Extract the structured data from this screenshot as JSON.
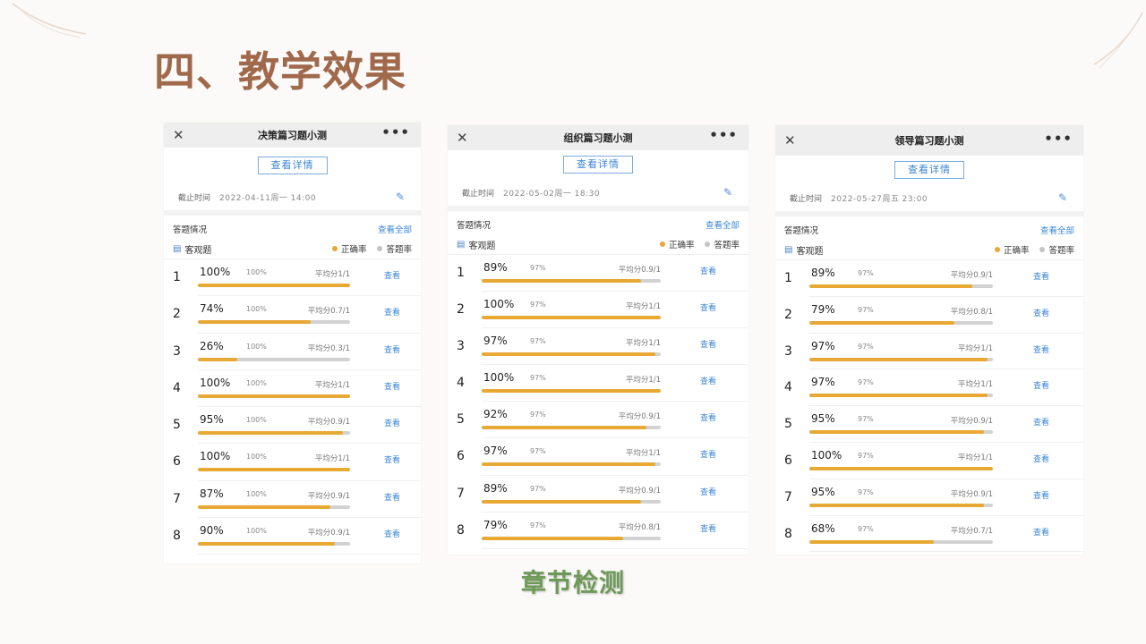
{
  "slide": {
    "title": "四、教学效果",
    "caption": "章节检测"
  },
  "common": {
    "detail_button": "查看详情",
    "deadline_label": "截止时间",
    "section_title": "答题情况",
    "view_all": "查看全部",
    "objective_label": "客观题",
    "legend_correct": "正确率",
    "legend_answered": "答题率",
    "view_label": "查看",
    "close_glyph": "✕",
    "more_glyph": "•••",
    "edit_glyph": "✎",
    "doc_glyph": "▤",
    "icons": [
      "close-icon",
      "more-icon",
      "edit-icon",
      "document-icon"
    ],
    "colors": {
      "correct": "#e7a934",
      "answered": "#c4c4c4",
      "link": "#3b86d6",
      "title": "#a0694b",
      "caption": "#6e9a58"
    }
  },
  "panels": [
    {
      "title": "决策篇习题小测",
      "deadline": "2022-04-11周一 14:00",
      "questions": [
        {
          "num": "1",
          "pct": "100%",
          "rate": 1.0,
          "avg": "100%",
          "score": "平均分1/1"
        },
        {
          "num": "2",
          "pct": "74%",
          "rate": 0.74,
          "avg": "100%",
          "score": "平均分0.7/1"
        },
        {
          "num": "3",
          "pct": "26%",
          "rate": 0.26,
          "avg": "100%",
          "score": "平均分0.3/1"
        },
        {
          "num": "4",
          "pct": "100%",
          "rate": 1.0,
          "avg": "100%",
          "score": "平均分1/1"
        },
        {
          "num": "5",
          "pct": "95%",
          "rate": 0.95,
          "avg": "100%",
          "score": "平均分0.9/1"
        },
        {
          "num": "6",
          "pct": "100%",
          "rate": 1.0,
          "avg": "100%",
          "score": "平均分1/1"
        },
        {
          "num": "7",
          "pct": "87%",
          "rate": 0.87,
          "avg": "100%",
          "score": "平均分0.9/1"
        },
        {
          "num": "8",
          "pct": "90%",
          "rate": 0.9,
          "avg": "100%",
          "score": "平均分0.9/1"
        }
      ]
    },
    {
      "title": "组织篇习题小测",
      "deadline": "2022-05-02周一 18:30",
      "questions": [
        {
          "num": "1",
          "pct": "89%",
          "rate": 0.89,
          "avg": "97%",
          "score": "平均分0.9/1"
        },
        {
          "num": "2",
          "pct": "100%",
          "rate": 1.0,
          "avg": "97%",
          "score": "平均分1/1"
        },
        {
          "num": "3",
          "pct": "97%",
          "rate": 0.97,
          "avg": "97%",
          "score": "平均分1/1"
        },
        {
          "num": "4",
          "pct": "100%",
          "rate": 1.0,
          "avg": "97%",
          "score": "平均分1/1"
        },
        {
          "num": "5",
          "pct": "92%",
          "rate": 0.92,
          "avg": "97%",
          "score": "平均分0.9/1"
        },
        {
          "num": "6",
          "pct": "97%",
          "rate": 0.97,
          "avg": "97%",
          "score": "平均分1/1"
        },
        {
          "num": "7",
          "pct": "89%",
          "rate": 0.89,
          "avg": "97%",
          "score": "平均分0.9/1"
        },
        {
          "num": "8",
          "pct": "79%",
          "rate": 0.79,
          "avg": "97%",
          "score": "平均分0.8/1"
        }
      ]
    },
    {
      "title": "领导篇习题小测",
      "deadline": "2022-05-27周五 23:00",
      "questions": [
        {
          "num": "1",
          "pct": "89%",
          "rate": 0.89,
          "avg": "97%",
          "score": "平均分0.9/1"
        },
        {
          "num": "2",
          "pct": "79%",
          "rate": 0.79,
          "avg": "97%",
          "score": "平均分0.8/1"
        },
        {
          "num": "3",
          "pct": "97%",
          "rate": 0.97,
          "avg": "97%",
          "score": "平均分1/1"
        },
        {
          "num": "4",
          "pct": "97%",
          "rate": 0.97,
          "avg": "97%",
          "score": "平均分1/1"
        },
        {
          "num": "5",
          "pct": "95%",
          "rate": 0.95,
          "avg": "97%",
          "score": "平均分0.9/1"
        },
        {
          "num": "6",
          "pct": "100%",
          "rate": 1.0,
          "avg": "97%",
          "score": "平均分1/1"
        },
        {
          "num": "7",
          "pct": "95%",
          "rate": 0.95,
          "avg": "97%",
          "score": "平均分0.9/1"
        },
        {
          "num": "8",
          "pct": "68%",
          "rate": 0.68,
          "avg": "97%",
          "score": "平均分0.7/1"
        }
      ]
    }
  ]
}
